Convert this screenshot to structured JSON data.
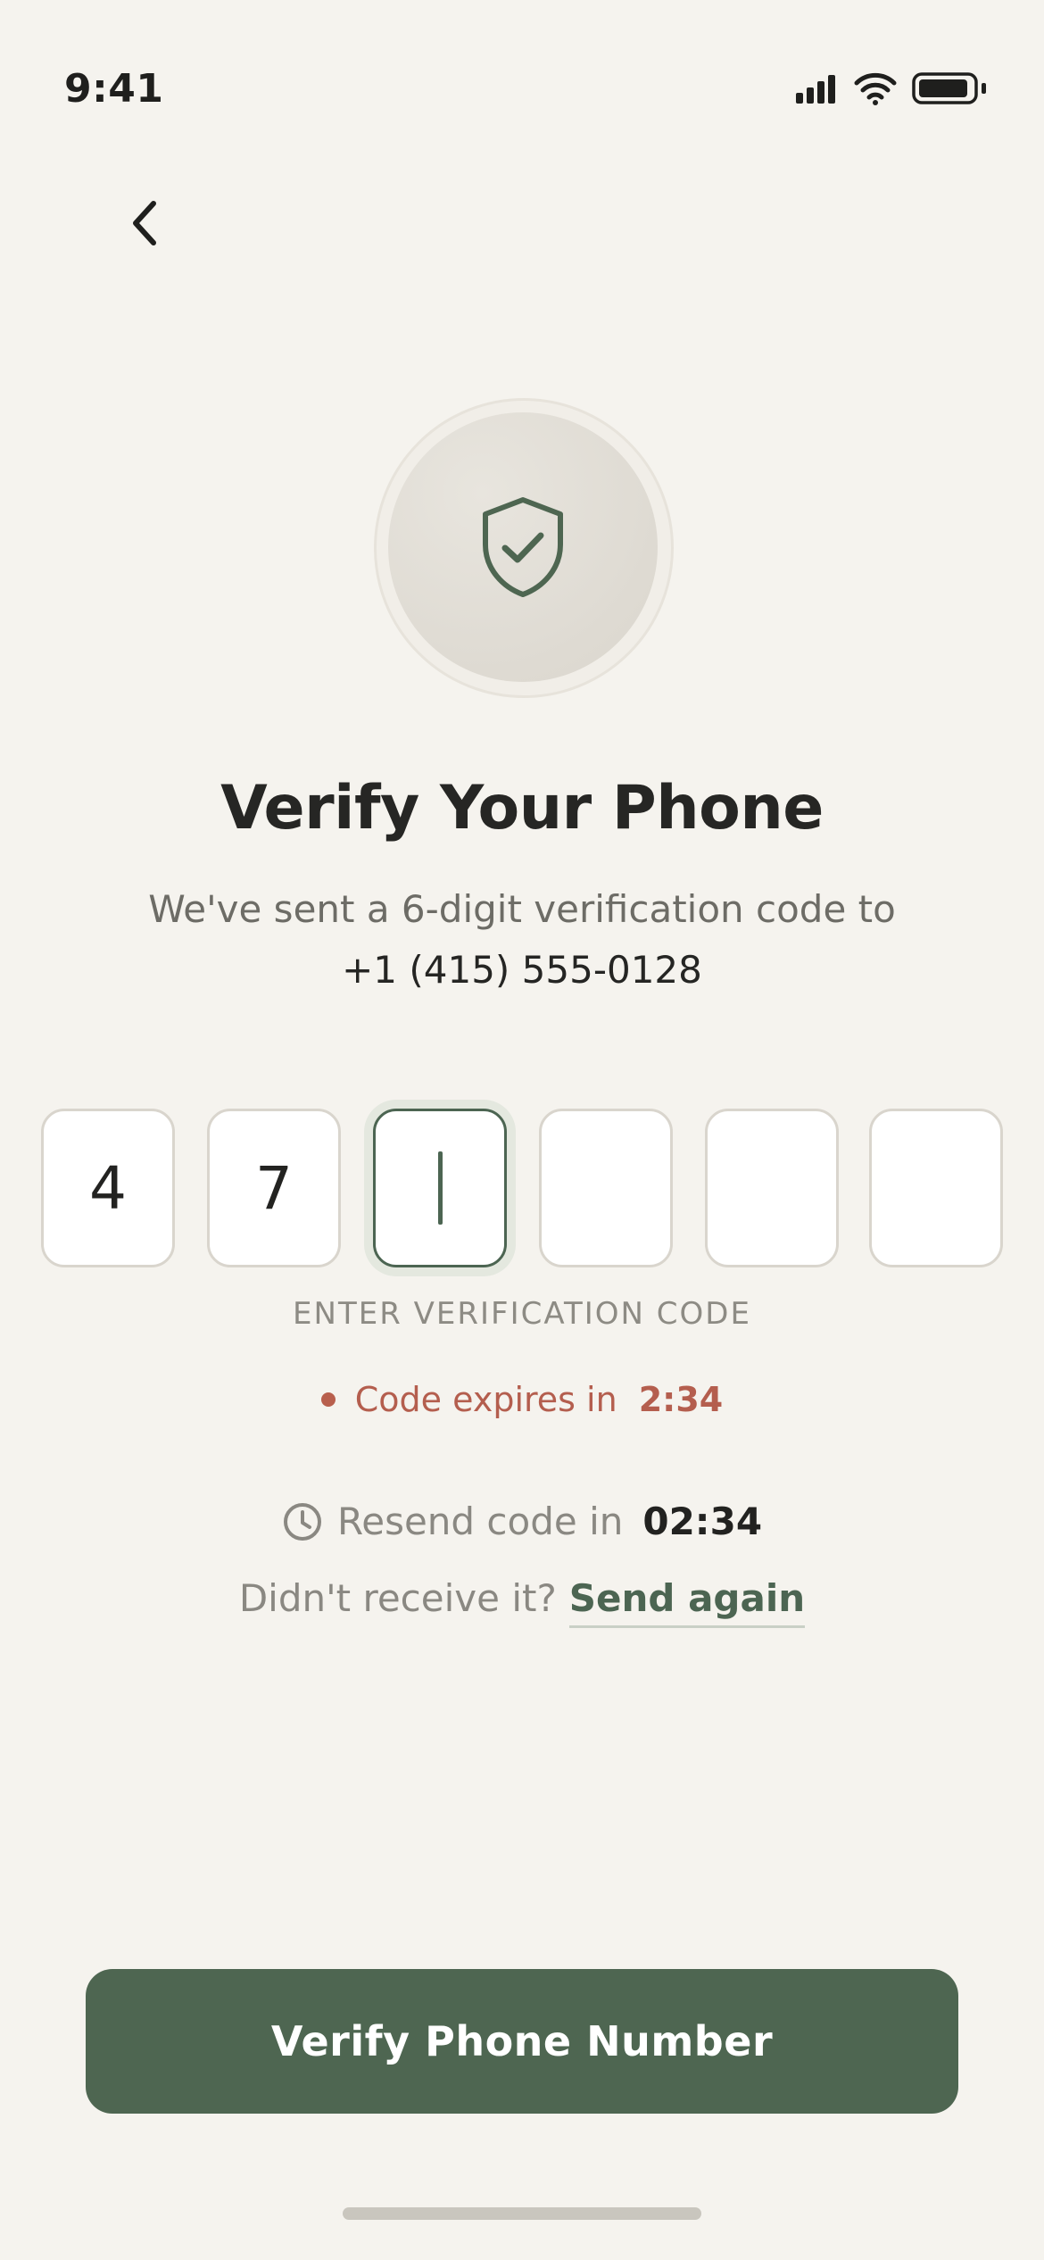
{
  "status_bar": {
    "time": "9:41",
    "icons": [
      "signal-icon",
      "wifi-icon",
      "battery-icon"
    ]
  },
  "nav": {
    "back_icon": "chevron-left-icon"
  },
  "badge": {
    "icon": "shield-check-icon"
  },
  "content": {
    "title": "Verify Your Phone",
    "subtitle": "We've sent a 6-digit verification code to",
    "phone_number": "+1 (415) 555-0128"
  },
  "code_input": {
    "digits": [
      "4",
      "7",
      "",
      "",
      "",
      ""
    ],
    "active_index": 2,
    "label": "ENTER VERIFICATION CODE"
  },
  "expiry": {
    "label": "Code expires in",
    "time": "2:34"
  },
  "resend": {
    "icon": "clock-icon",
    "label": "Resend code in",
    "time": "02:34",
    "prompt": "Didn't receive it?",
    "link": "Send again"
  },
  "actions": {
    "verify_label": "Verify Phone Number"
  },
  "colors": {
    "background": "#f5f3ee",
    "accent": "#4e6651",
    "error": "#b45e4e",
    "muted_text": "#8a8882"
  }
}
